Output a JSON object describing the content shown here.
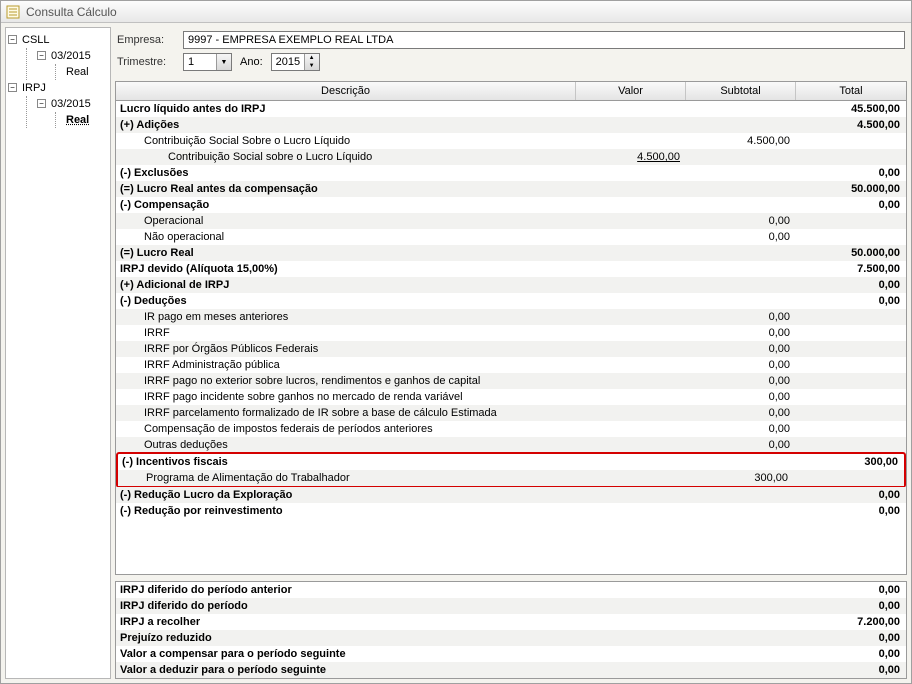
{
  "window": {
    "title": "Consulta Cálculo"
  },
  "tree": {
    "csll": "CSLL",
    "csll_period": "03/2015",
    "csll_real": "Real",
    "irpj": "IRPJ",
    "irpj_period": "03/2015",
    "irpj_real": "Real"
  },
  "fields": {
    "empresa_label": "Empresa:",
    "empresa_value": "9997 - EMPRESA EXEMPLO REAL LTDA",
    "trimestre_label": "Trimestre:",
    "trimestre_value": "1",
    "ano_label": "Ano:",
    "ano_value": "2015"
  },
  "headers": {
    "desc": "Descrição",
    "valor": "Valor",
    "subtotal": "Subtotal",
    "total": "Total"
  },
  "rows": [
    {
      "d": "Lucro líquido antes do IRPJ",
      "t": "45.500,00",
      "b": true
    },
    {
      "d": "(+) Adições",
      "t": "4.500,00",
      "b": true
    },
    {
      "d": "Contribuição Social Sobre o Lucro Líquido",
      "s": "4.500,00",
      "i": 1
    },
    {
      "d": "Contribuição Social sobre o Lucro Líquido",
      "v": "4.500,00",
      "i": 2,
      "u": true
    },
    {
      "d": "(-) Exclusões",
      "t": "0,00",
      "b": true
    },
    {
      "d": "(=) Lucro Real antes da compensação",
      "t": "50.000,00",
      "b": true
    },
    {
      "d": "(-) Compensação",
      "t": "0,00",
      "b": true
    },
    {
      "d": "Operacional",
      "s": "0,00",
      "i": 1
    },
    {
      "d": "Não operacional",
      "s": "0,00",
      "i": 1
    },
    {
      "d": "(=) Lucro Real",
      "t": "50.000,00",
      "b": true
    },
    {
      "d": "IRPJ devido (Alíquota 15,00%)",
      "t": "7.500,00",
      "b": true
    },
    {
      "d": "(+) Adicional de IRPJ",
      "t": "0,00",
      "b": true
    },
    {
      "d": "(-) Deduções",
      "t": "0,00",
      "b": true
    },
    {
      "d": "IR pago em meses anteriores",
      "s": "0,00",
      "i": 1
    },
    {
      "d": "IRRF",
      "s": "0,00",
      "i": 1
    },
    {
      "d": "IRRF por Órgãos Públicos Federais",
      "s": "0,00",
      "i": 1
    },
    {
      "d": "IRRF Administração pública",
      "s": "0,00",
      "i": 1
    },
    {
      "d": "IRRF pago no exterior sobre lucros, rendimentos e ganhos de capital",
      "s": "0,00",
      "i": 1
    },
    {
      "d": "IRRF pago incidente sobre ganhos no mercado de renda variável",
      "s": "0,00",
      "i": 1
    },
    {
      "d": "IRRF parcelamento formalizado de IR sobre a base de cálculo Estimada",
      "s": "0,00",
      "i": 1
    },
    {
      "d": "Compensação de impostos federais de períodos anteriores",
      "s": "0,00",
      "i": 1
    },
    {
      "d": "Outras deduções",
      "s": "0,00",
      "i": 1
    },
    {
      "d": "(-) Incentivos fiscais",
      "t": "300,00",
      "b": true,
      "hl": "start"
    },
    {
      "d": "Programa de Alimentação do Trabalhador",
      "s": "300,00",
      "i": 1,
      "hl": "end"
    },
    {
      "d": "(-) Redução Lucro da Exploração",
      "t": "0,00",
      "b": true
    },
    {
      "d": "(-) Redução por reinvestimento",
      "t": "0,00",
      "b": true
    }
  ],
  "summary": [
    {
      "d": "IRPJ diferido do período anterior",
      "t": "0,00",
      "b": true
    },
    {
      "d": "IRPJ diferido do período",
      "t": "0,00",
      "b": true
    },
    {
      "d": "IRPJ a recolher",
      "t": "7.200,00",
      "b": true
    },
    {
      "d": "Prejuízo reduzido",
      "t": "0,00",
      "b": true
    },
    {
      "d": "Valor a compensar para o período seguinte",
      "t": "0,00",
      "b": true
    },
    {
      "d": "Valor a deduzir para o período seguinte",
      "t": "0,00",
      "b": true
    }
  ]
}
